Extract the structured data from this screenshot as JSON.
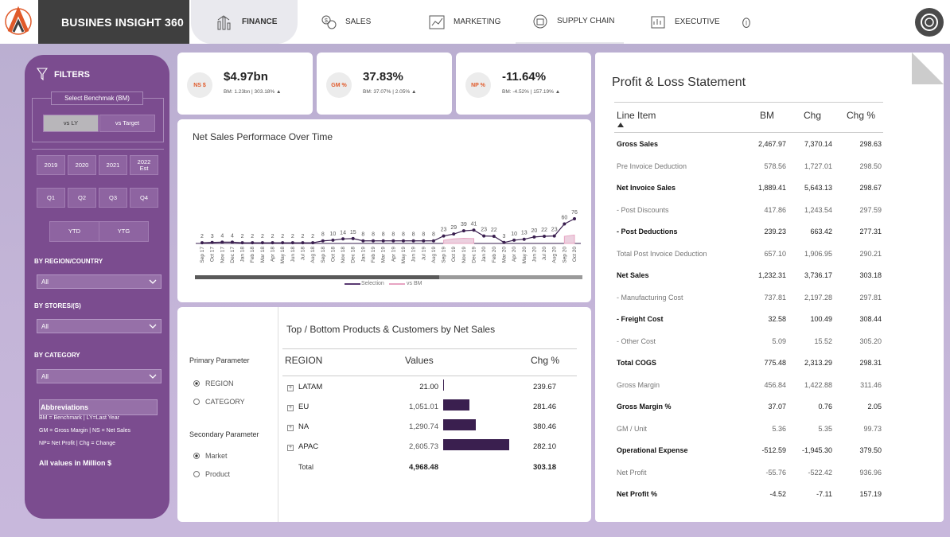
{
  "brand": "BUSINES INSIGHT 360",
  "nav": {
    "finance": "FINANCE",
    "sales": "SALES",
    "marketing": "MARKETING",
    "supply_chain": "SUPPLY CHAIN",
    "executive": "EXECUTIVE"
  },
  "filters": {
    "title": "FILTERS",
    "benchmark_label": "Select Benchmak (BM)",
    "vs_ly": "vs LY",
    "vs_target": "vs Target",
    "years": [
      "2019",
      "2020",
      "2021",
      "2022\nEst"
    ],
    "quarters": [
      "Q1",
      "Q2",
      "Q3",
      "Q4"
    ],
    "ytd": "YTD",
    "ytg": "YTG",
    "region_label": "BY REGION/COUNTRY",
    "region_value": "All",
    "stores_label": "BY STORES/(S)",
    "stores_value": "All",
    "category_label": "BY CATEGORY",
    "category_value": "All",
    "abbr_title": "Abbreviations",
    "abbr_lines": [
      "BM = Benchmark | LY=Last Year",
      "GM = Gross Margin | NS = Net Sales",
      "NP= Net Profit | Chg = Change"
    ],
    "units_note": "All values in Million $"
  },
  "kpis": [
    {
      "badge": "NS $",
      "value": "$4.97bn",
      "sub": "BM: 1.23bn | 303.18% ▲"
    },
    {
      "badge": "GM %",
      "value": "37.83%",
      "sub": "BM: 37.07% | 2.05% ▲"
    },
    {
      "badge": "NP %",
      "value": "-11.64%",
      "sub": "BM: -4.52% | 157.19% ▲"
    }
  ],
  "chart_data": {
    "type": "line",
    "title": "Net Sales Performace Over Time",
    "categories": [
      "Sep 17",
      "Oct 17",
      "Nov 17",
      "Dec 17",
      "Jan 18",
      "Feb 18",
      "Mar 18",
      "Apr 18",
      "May 18",
      "Jun 18",
      "Jul 18",
      "Aug 18",
      "Sep 18",
      "Oct 18",
      "Nov 18",
      "Dec 18",
      "Jan 19",
      "Feb 19",
      "Mar 19",
      "Apr 19",
      "May 19",
      "Jun 19",
      "Jul 19",
      "Aug 19",
      "Sep 19",
      "Oct 19",
      "Nov 19",
      "Dec 19",
      "Jan 20",
      "Feb 20",
      "Mar 20",
      "Apr 20",
      "May 20",
      "Jun 20",
      "Jul 20",
      "Aug 20",
      "Sep 20",
      "Oct 20"
    ],
    "series": [
      {
        "name": "Selection",
        "values": [
          2,
          3,
          4,
          4,
          2,
          2,
          2,
          2,
          2,
          2,
          2,
          2,
          8,
          10,
          14,
          15,
          8,
          8,
          8,
          8,
          8,
          8,
          8,
          8,
          23,
          29,
          39,
          41,
          23,
          22,
          3,
          10,
          13,
          20,
          22,
          23,
          60,
          76
        ],
        "color": "#3a1f4f"
      },
      {
        "name": "vs BM",
        "values": [
          null,
          null,
          null,
          null,
          null,
          null,
          null,
          null,
          null,
          null,
          null,
          null,
          null,
          null,
          null,
          null,
          null,
          null,
          null,
          null,
          null,
          null,
          null,
          null,
          10,
          14,
          16,
          15,
          null,
          null,
          null,
          null,
          null,
          null,
          null,
          null,
          22,
          26
        ],
        "color": "#e7a4c2"
      }
    ],
    "legend": [
      "Selection",
      "vs BM"
    ],
    "legend_position": "bottom"
  },
  "topbottom": {
    "title": "Top / Bottom Products & Customers by Net Sales",
    "primary_label": "Primary Parameter",
    "primary_options": [
      "REGION",
      "CATEGORY"
    ],
    "secondary_label": "Secondary Parameter",
    "secondary_options": [
      "Market",
      "Product"
    ],
    "col_region": "REGION",
    "col_values": "Values",
    "col_chg": "Chg %",
    "rows": [
      {
        "region": "LATAM",
        "value": "21.00",
        "num": 21.0,
        "chg": "239.67"
      },
      {
        "region": "EU",
        "value": "1,051.01",
        "num": 1051.01,
        "chg": "281.46"
      },
      {
        "region": "NA",
        "value": "1,290.74",
        "num": 1290.74,
        "chg": "380.46"
      },
      {
        "region": "APAC",
        "value": "2,605.73",
        "num": 2605.73,
        "chg": "282.10"
      }
    ],
    "total_label": "Total",
    "total_value": "4,968.48",
    "total_chg": "303.18"
  },
  "pl": {
    "title": "Profit & Loss Statement",
    "col_item": "Line Item",
    "col_bm": "BM",
    "col_chg": "Chg",
    "col_chgp": "Chg %",
    "rows": [
      {
        "item": "Gross Sales",
        "bm": "2,467.97",
        "chg": "7,370.14",
        "chgp": "298.63",
        "bold": true
      },
      {
        "item": "Pre Invoice Deduction",
        "bm": "578.56",
        "chg": "1,727.01",
        "chgp": "298.50",
        "bold": false
      },
      {
        "item": "Net Invoice Sales",
        "bm": "1,889.41",
        "chg": "5,643.13",
        "chgp": "298.67",
        "bold": true
      },
      {
        "item": "- Post Discounts",
        "bm": "417.86",
        "chg": "1,243.54",
        "chgp": "297.59",
        "bold": false
      },
      {
        "item": "- Post Deductions",
        "bm": "239.23",
        "chg": "663.42",
        "chgp": "277.31",
        "bold": true
      },
      {
        "item": "Total Post Invoice Deduction",
        "bm": "657.10",
        "chg": "1,906.95",
        "chgp": "290.21",
        "bold": false
      },
      {
        "item": "Net Sales",
        "bm": "1,232.31",
        "chg": "3,736.17",
        "chgp": "303.18",
        "bold": true
      },
      {
        "item": "- Manufacturing Cost",
        "bm": "737.81",
        "chg": "2,197.28",
        "chgp": "297.81",
        "bold": false
      },
      {
        "item": "- Freight Cost",
        "bm": "32.58",
        "chg": "100.49",
        "chgp": "308.44",
        "bold": true
      },
      {
        "item": "- Other Cost",
        "bm": "5.09",
        "chg": "15.52",
        "chgp": "305.20",
        "bold": false
      },
      {
        "item": "Total COGS",
        "bm": "775.48",
        "chg": "2,313.29",
        "chgp": "298.31",
        "bold": true
      },
      {
        "item": "Gross Margin",
        "bm": "456.84",
        "chg": "1,422.88",
        "chgp": "311.46",
        "bold": false
      },
      {
        "item": "Gross Margin %",
        "bm": "37.07",
        "chg": "0.76",
        "chgp": "2.05",
        "bold": true
      },
      {
        "item": "GM / Unit",
        "bm": "5.36",
        "chg": "5.35",
        "chgp": "99.73",
        "bold": false
      },
      {
        "item": "Operational Expense",
        "bm": "-512.59",
        "chg": "-1,945.30",
        "chgp": "379.50",
        "bold": true
      },
      {
        "item": "Net Profit",
        "bm": "-55.76",
        "chg": "-522.42",
        "chgp": "936.96",
        "bold": false
      },
      {
        "item": "Net Profit %",
        "bm": "-4.52",
        "chg": "-7.11",
        "chgp": "157.19",
        "bold": true
      }
    ]
  },
  "colors": {
    "accent": "#7b4c8f",
    "dark_purple": "#3a1f4f",
    "badge_text": "#e05a2a"
  }
}
